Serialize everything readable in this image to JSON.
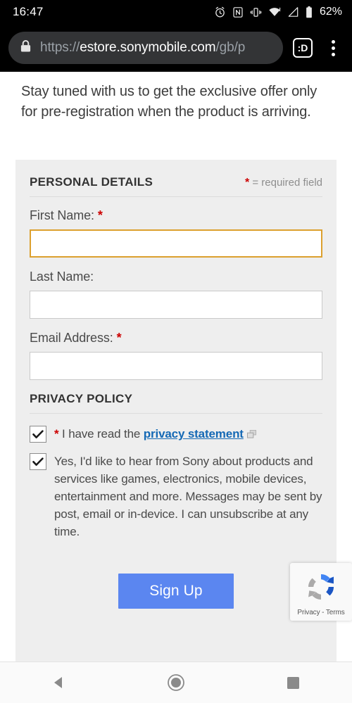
{
  "status_bar": {
    "clock": "16:47",
    "battery_percent": "62%",
    "icons": [
      "alarm-icon",
      "nfc-icon",
      "vibrate-icon",
      "wifi-icon",
      "signal-icon",
      "battery-icon"
    ]
  },
  "browser": {
    "url_scheme": "https://",
    "url_domain": "estore.sonymobile.com",
    "url_path": "/gb/p",
    "lock_icon": "lock-icon",
    "tab_count_label": ":D",
    "menu_icon": "overflow-menu-icon"
  },
  "page": {
    "intro_text": "Stay tuned with us to get the exclusive offer only for pre-registration when the product is arriving.",
    "personal_details": {
      "section_title": "PERSONAL DETAILS",
      "required_star": "*",
      "required_note": "= required field",
      "fields": [
        {
          "label": "First Name:",
          "required": "*",
          "value": "",
          "placeholder": "",
          "focused": true
        },
        {
          "label": "Last Name:",
          "required": "",
          "value": "",
          "placeholder": "",
          "focused": false
        },
        {
          "label": "Email Address:",
          "required": "*",
          "value": "",
          "placeholder": "",
          "focused": false
        }
      ]
    },
    "privacy_policy": {
      "section_title": "PRIVACY POLICY",
      "consent_star": "*",
      "consent_prefix": "I have read the",
      "consent_link": "privacy statement",
      "external_link_icon": "external-link-icon",
      "consent_checked": true,
      "marketing_text": "Yes, I'd like to hear from Sony about products and services like games, electronics, mobile devices, entertainment and more. Messages may be sent by post, email or in-device. I can unsubscribe at any time.",
      "marketing_checked": true
    },
    "submit_label": "Sign Up",
    "submit_color": "#5b86f0",
    "focus_border_color": "#dca02e",
    "required_color": "#cc0000",
    "link_color": "#1569b5",
    "panel_bg": "#eeeeee"
  },
  "recaptcha": {
    "text": "Privacy - Terms",
    "logo_icon": "recaptcha-icon"
  },
  "nav_bar": {
    "back_label": "back-icon",
    "home_label": "home-icon",
    "recents_label": "recents-icon"
  }
}
